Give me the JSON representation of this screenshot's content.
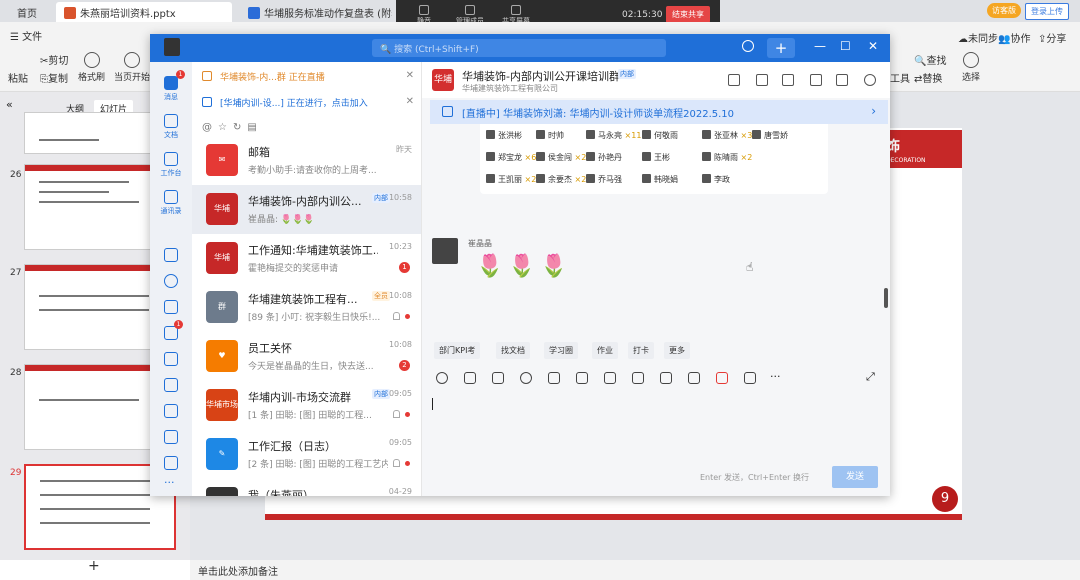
{
  "browser_tabs": {
    "home": "首页",
    "tab1": "朱燕丽培训资料.pptx",
    "tab2": "华埔服务标准动作复盘表 (附表2)"
  },
  "meeting": {
    "items": [
      "静音",
      "管理成员",
      "共享屏幕"
    ],
    "timer": "02:15:30",
    "end_share": "结束共享"
  },
  "top_right": {
    "visitor": "访客版",
    "login": "登录上传"
  },
  "ribbon": {
    "file": "文件",
    "cut": "剪切",
    "copy": "复制",
    "paste": "粘贴",
    "format_painter": "格式刷",
    "current_start": "当页开始",
    "find": "查找",
    "replace": "替换",
    "select": "选择",
    "tools": "工具",
    "unsynced": "未同步",
    "collab": "协作",
    "share": "分享"
  },
  "slide_pane": {
    "tabs": [
      "大纲",
      "幻灯片"
    ],
    "numbers": [
      "26",
      "27",
      "28",
      "29"
    ],
    "add": "+"
  },
  "notes_placeholder": "单击此处添加备注",
  "slide": {
    "brand_cn": "埔装饰",
    "brand_en": "DECORATION",
    "page": "9"
  },
  "chat": {
    "search_placeholder": "搜索 (Ctrl+Shift+F)",
    "nav": [
      {
        "label": "消息",
        "badge": "1"
      },
      {
        "label": "文档"
      },
      {
        "label": "工作台"
      },
      {
        "label": "通讯录"
      }
    ],
    "nav_badge2": "1",
    "banner1": "华埔装饰-内...群 正在直播",
    "banner2": "[华埔内训-设...] 正在进行，点击加入",
    "conversations": [
      {
        "title": "邮箱",
        "sub": "考勤小助手:请查收你的上周考...",
        "time": "昨天",
        "avatar": "✉",
        "color": "#e53935"
      },
      {
        "title": "华埔装饰-内部内训公...",
        "tag": "内部",
        "sub": "崔晶晶: 🌷🌷🌷",
        "time": "10:58",
        "avatar": "华埔",
        "color": "#c62828"
      },
      {
        "title": "工作通知:华埔建筑装饰工...",
        "sub": "霍艳梅提交的奖惩申请",
        "time": "10:23",
        "avatar": "华埔",
        "color": "#c62828",
        "badge": "1"
      },
      {
        "title": "华埔建筑装饰工程有...",
        "tag": "全员",
        "sub": "[89 条] 小叮: 祝李毅生日快乐!...",
        "time": "10:08",
        "avatar": "群",
        "color": "#6d7b8c"
      },
      {
        "title": "员工关怀",
        "sub": "今天是崔晶晶的生日，快去送...",
        "time": "10:08",
        "avatar": "♥",
        "color": "#f57c00",
        "badge": "2"
      },
      {
        "title": "华埔内训-市场交流群",
        "tag": "内部",
        "sub": "[1 条] 田聪: [图] 田聪的工程...",
        "time": "09:05",
        "avatar": "华埔市场",
        "color": "#d84315"
      },
      {
        "title": "工作汇报（日志）",
        "sub": "[2 条] 田聪: [图] 田聪的工程工艺内...",
        "time": "09:05",
        "avatar": "✎",
        "color": "#1e88e5"
      },
      {
        "title": "我（朱燕丽）",
        "sub": "",
        "time": "04-29",
        "avatar": "我",
        "color": "#333"
      }
    ],
    "group": {
      "name": "华埔装饰-内部内训公开课培训群",
      "tag": "内部",
      "company": "华埔建筑装饰工程有限公司"
    },
    "live_text": "[直播中] 华埔装饰刘潇: 华埔内训-设计师谈单流程2022.5.10",
    "names": [
      {
        "n": "张洪彬",
        "c": ""
      },
      {
        "n": "时帅",
        "c": ""
      },
      {
        "n": "马永亮",
        "c": "×11"
      },
      {
        "n": "何敬雨",
        "c": ""
      },
      {
        "n": "张亚林",
        "c": "×3"
      },
      {
        "n": "唐雪娇",
        "c": ""
      },
      {
        "n": "郑宝龙",
        "c": "×65"
      },
      {
        "n": "侯金闯",
        "c": "×2"
      },
      {
        "n": "孙艳丹",
        "c": ""
      },
      {
        "n": "王彬",
        "c": ""
      },
      {
        "n": "陈晴雨",
        "c": "×2"
      },
      {
        "n": "王凯丽",
        "c": "×2"
      },
      {
        "n": "余要杰",
        "c": "×2"
      },
      {
        "n": "乔马强",
        "c": ""
      },
      {
        "n": "韩晓娟",
        "c": ""
      },
      {
        "n": "李政",
        "c": ""
      }
    ],
    "sender_name": "崔晶晶",
    "flowers": [
      "🌷",
      "🌷",
      "🌷"
    ],
    "quick": [
      "部门KPI考",
      "找文档",
      "学习圈",
      "作业",
      "打卡",
      "更多"
    ],
    "send_hint": "Enter 发送，Ctrl+Enter 换行",
    "send": "发送"
  }
}
